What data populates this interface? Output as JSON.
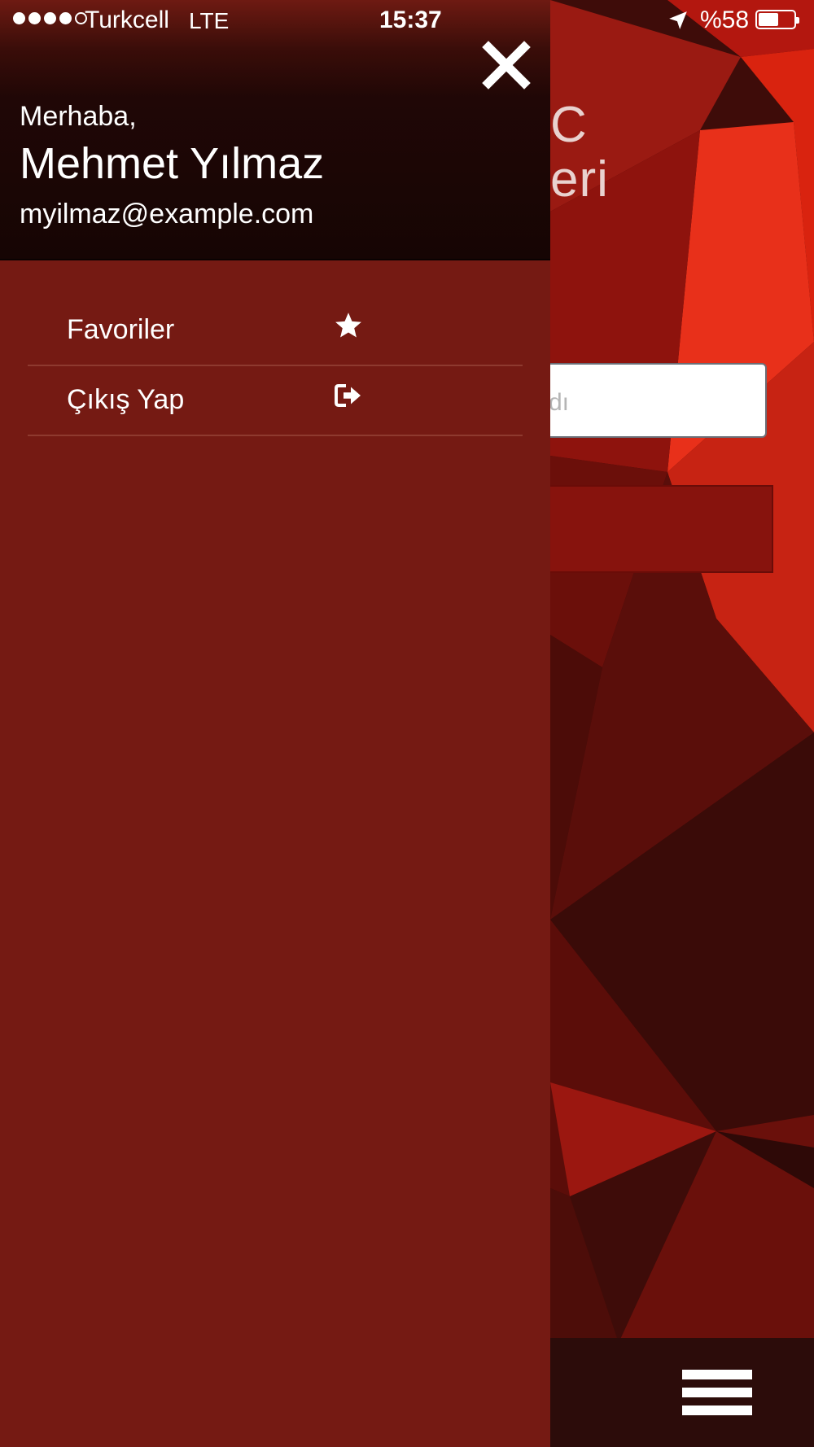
{
  "status_bar": {
    "signal_bars_filled": 4,
    "signal_bars_total": 5,
    "carrier": "Turkcell",
    "network": "LTE",
    "time": "15:37",
    "battery_text": "%58",
    "battery_level": 0.58
  },
  "drawer": {
    "greeting": "Merhaba,",
    "user_name": "Mehmet Yılmaz",
    "user_email": "myilmaz@example.com",
    "close_icon": "close-icon",
    "menu_items": [
      {
        "label": "Favoriler",
        "icon": "star-icon"
      },
      {
        "label": "Çıkış Yap",
        "icon": "sign-out-icon"
      }
    ]
  },
  "background_app": {
    "title_fragment_1": "C",
    "title_fragment_2": "eri",
    "input_placeholder_fragment": "dı",
    "menu_icon": "hamburger-menu-icon"
  },
  "colors": {
    "drawer_bg": "#751a13",
    "header_bg": "#160504",
    "accent_red": "#87130d",
    "divider": "#8e3a2f"
  }
}
